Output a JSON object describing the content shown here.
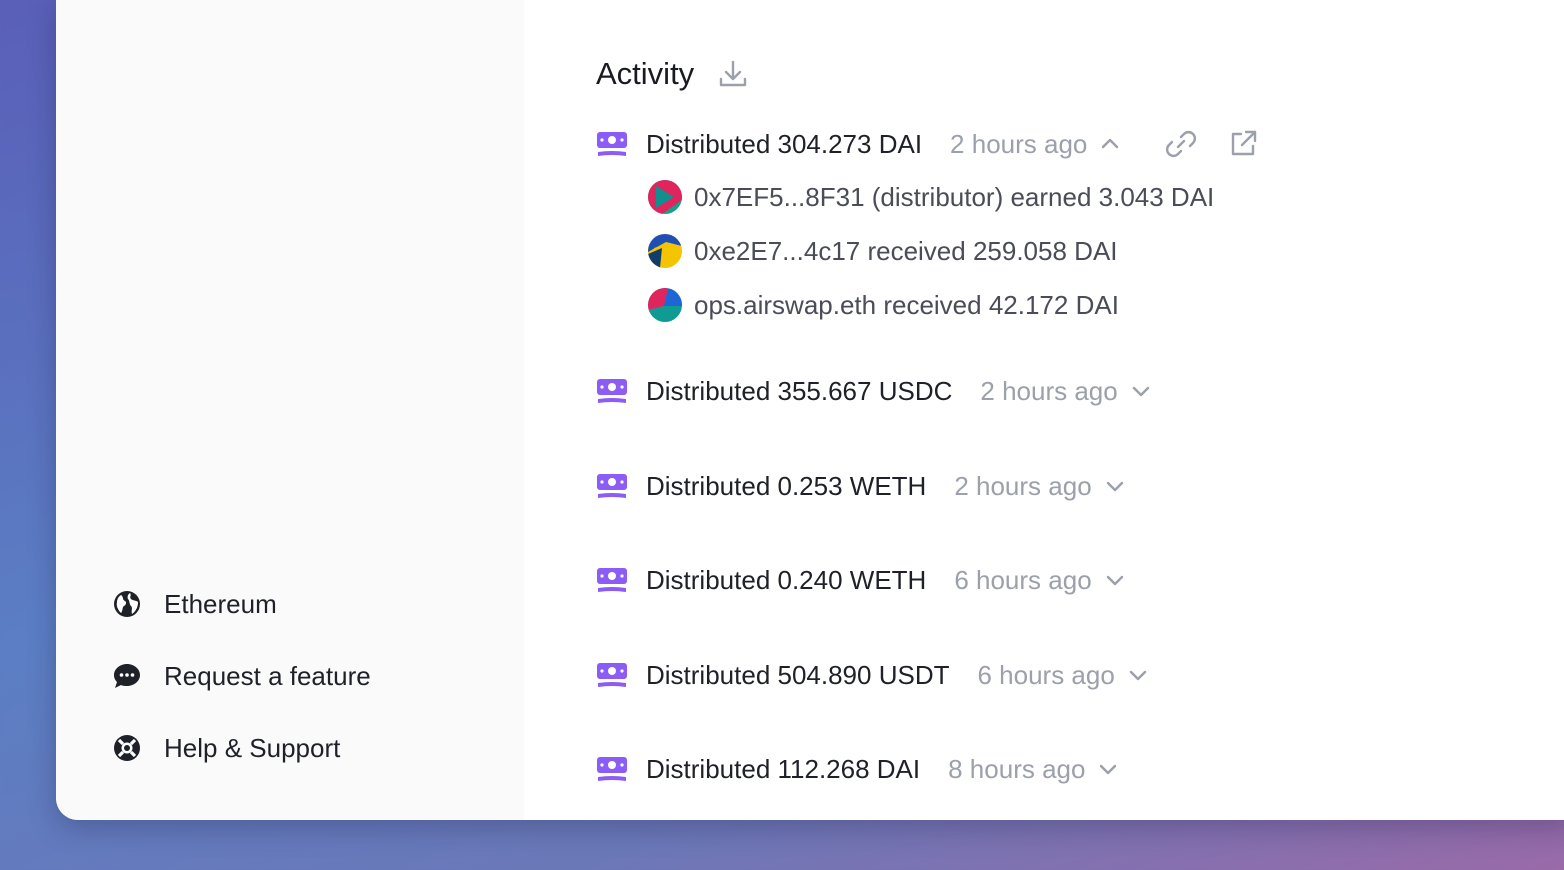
{
  "sidebar": {
    "items": [
      {
        "label": "Ethereum",
        "icon": "globe-icon"
      },
      {
        "label": "Request a feature",
        "icon": "chat-bubble-icon"
      },
      {
        "label": "Help & Support",
        "icon": "lifebuoy-icon"
      }
    ]
  },
  "activity": {
    "title": "Activity",
    "events": [
      {
        "text": "Distributed 304.273 DAI",
        "time": "2 hours ago",
        "expanded": true,
        "details": [
          {
            "text": "0x7EF5...8F31 (distributor) earned 3.043 DAI"
          },
          {
            "text": "0xe2E7...4c17 received 259.058 DAI"
          },
          {
            "text": "ops.airswap.eth received 42.172 DAI"
          }
        ]
      },
      {
        "text": "Distributed 355.667 USDC",
        "time": "2 hours ago",
        "expanded": false
      },
      {
        "text": "Distributed 0.253 WETH",
        "time": "2 hours ago",
        "expanded": false
      },
      {
        "text": "Distributed 0.240 WETH",
        "time": "6 hours ago",
        "expanded": false
      },
      {
        "text": "Distributed 504.890 USDT",
        "time": "6 hours ago",
        "expanded": false
      },
      {
        "text": "Distributed 112.268 DAI",
        "time": "8 hours ago",
        "expanded": false
      }
    ]
  },
  "colors": {
    "accent": "#8b5cf6",
    "muted": "#9ca0ab"
  }
}
